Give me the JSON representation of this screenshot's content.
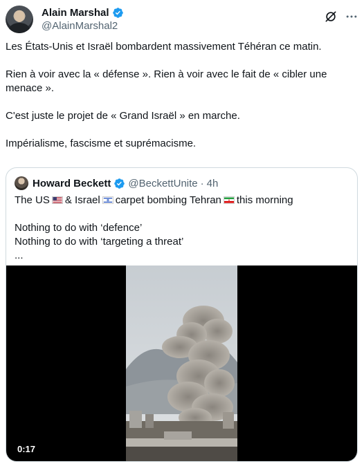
{
  "post": {
    "author_name": "Alain Marshal",
    "author_handle": "@AlainMarshal2",
    "paragraphs": [
      "Les États-Unis et Israël bombardent massivement Téhéran ce matin.",
      "Rien à voir avec la « défense ». Rien à voir avec le fait de « cibler une menace ».",
      "C'est juste le projet de « Grand Israël » en marche.",
      "Impérialisme, fascisme et suprémacisme."
    ]
  },
  "quote": {
    "author_name": "Howard Beckett",
    "author_handle": "@BeckettUnite",
    "separator": "·",
    "time": "4h",
    "line1_a": "The US",
    "line1_b": "& Israel",
    "line1_c": "carpet bombing Tehran",
    "line1_d": "this morning",
    "line2": "Nothing to do with ‘defence’",
    "line3": "Nothing to do with ‘targeting a threat’",
    "line4": "...",
    "video_duration": "0:17"
  },
  "icons": {
    "verified": "verified-badge-icon",
    "grok": "grok-icon",
    "more": "more-options-icon"
  },
  "colors": {
    "verified_blue": "#1d9bf0",
    "secondary_text": "#536471",
    "border": "#cfd9de"
  }
}
